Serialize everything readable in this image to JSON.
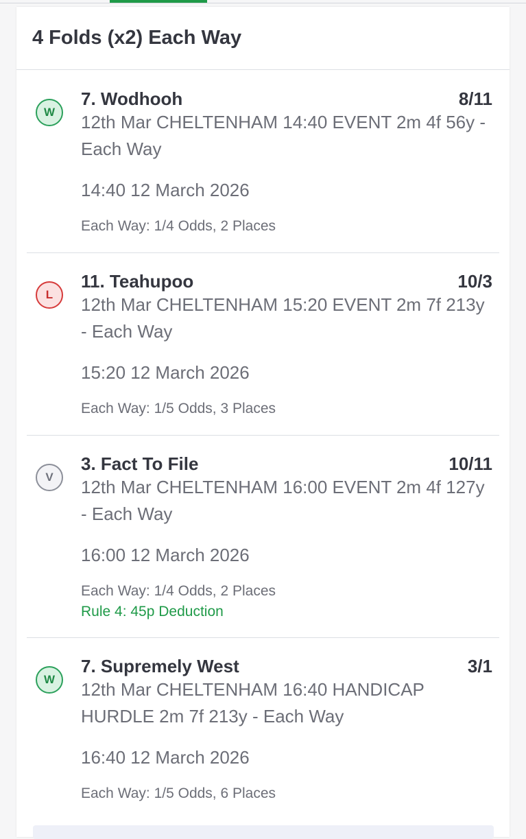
{
  "bet": {
    "title": "4 Folds (x2) Each Way"
  },
  "selections": [
    {
      "status": "W",
      "runner": "7. Wodhooh",
      "odds": "8/11",
      "event": "12th Mar CHELTENHAM 14:40 EVENT 2m 4f 56y - Each Way",
      "datetime": "14:40 12 March 2026",
      "terms": "Each Way: 1/4 Odds, 2 Places"
    },
    {
      "status": "L",
      "runner": "11. Teahupoo",
      "odds": "10/3",
      "event": "12th Mar CHELTENHAM 15:20 EVENT 2m 7f 213y - Each Way",
      "datetime": "15:20 12 March 2026",
      "terms": "Each Way: 1/5 Odds, 3 Places"
    },
    {
      "status": "V",
      "runner": "3. Fact To File",
      "odds": "10/11",
      "event": "12th Mar CHELTENHAM 16:00 EVENT 2m 4f 127y - Each Way",
      "datetime": "16:00 12 March 2026",
      "terms": "Each Way: 1/4 Odds, 2 Places",
      "rule4": "Rule 4: 45p Deduction"
    },
    {
      "status": "W",
      "runner": "7. Supremely West",
      "odds": "3/1",
      "event": "12th Mar CHELTENHAM 16:40 HANDICAP HURDLE 2m 7f 213y - Each Way",
      "datetime": "16:40 12 March 2026",
      "terms": "Each Way: 1/5 Odds, 6 Places"
    }
  ],
  "colors": {
    "win": "#2ba05b",
    "lose": "#d63a3a",
    "void": "#8c8f99",
    "accent": "#1f9a48",
    "text": "#34363f",
    "muted": "#6c6e77"
  }
}
